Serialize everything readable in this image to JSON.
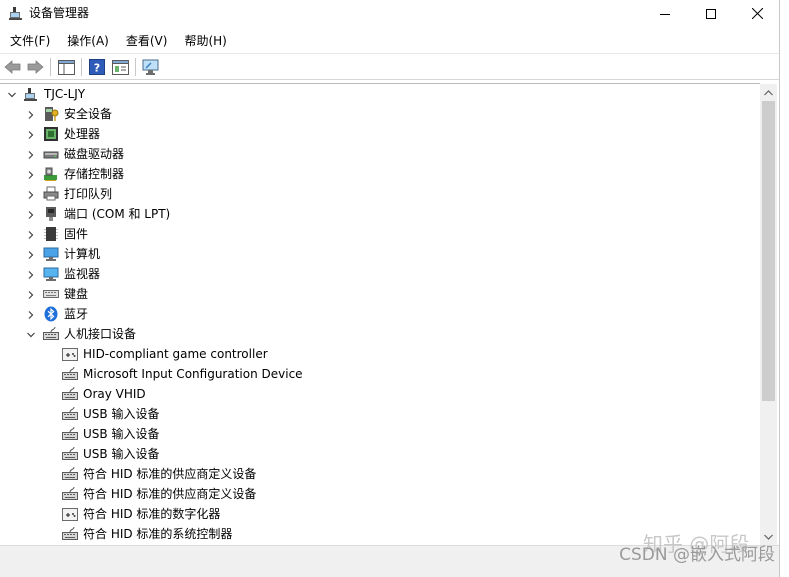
{
  "window": {
    "title": "设备管理器"
  },
  "menu": [
    "文件(F)",
    "操作(A)",
    "查看(V)",
    "帮助(H)"
  ],
  "tree": {
    "root": "TJC-LJY",
    "categories": [
      {
        "label": "安全设备",
        "icon": "security-device-icon",
        "expanded": false
      },
      {
        "label": "处理器",
        "icon": "processor-icon",
        "expanded": false
      },
      {
        "label": "磁盘驱动器",
        "icon": "disk-drive-icon",
        "expanded": false
      },
      {
        "label": "存储控制器",
        "icon": "storage-controller-icon",
        "expanded": false
      },
      {
        "label": "打印队列",
        "icon": "printer-icon",
        "expanded": false
      },
      {
        "label": "端口 (COM 和 LPT)",
        "icon": "port-icon",
        "expanded": false
      },
      {
        "label": "固件",
        "icon": "firmware-icon",
        "expanded": false
      },
      {
        "label": "计算机",
        "icon": "computer-icon",
        "expanded": false
      },
      {
        "label": "监视器",
        "icon": "monitor-icon",
        "expanded": false
      },
      {
        "label": "键盘",
        "icon": "keyboard-icon",
        "expanded": false
      },
      {
        "label": "蓝牙",
        "icon": "bluetooth-icon",
        "expanded": false
      },
      {
        "label": "人机接口设备",
        "icon": "hid-icon",
        "expanded": true
      }
    ],
    "hid_children": [
      "HID-compliant game controller",
      "Microsoft Input Configuration Device",
      "Oray VHID",
      "USB 输入设备",
      "USB 输入设备",
      "USB 输入设备",
      "符合 HID 标准的供应商定义设备",
      "符合 HID 标准的供应商定义设备",
      "符合 HID 标准的数字化器",
      "符合 HID 标准的系统控制器"
    ]
  },
  "watermark": "CSDN @嵌入式阿段",
  "watermark_faint": "知乎 @阿段",
  "colors": {
    "accent": "#0078d7",
    "bluetooth": "#1e6fd9"
  }
}
